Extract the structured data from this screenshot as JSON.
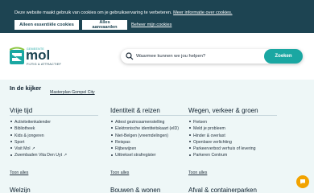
{
  "cookie": {
    "text": "Deze website maakt gebruik van cookies om je gebruikservaring te verbeteren.",
    "more_link": "Meer informatie over cookies.",
    "btn_essential": "Alleen essentiële cookies",
    "btn_adjust": "Alles aanvaarden",
    "reject_link": "Beheer mijn cookies"
  },
  "header": {
    "logo_top": "GEMEENTE",
    "logo_name": "mol",
    "logo_tagline": "FIJTIG & ATTRACTIEF",
    "search_placeholder": "Waarmee kunnen we jou helpen?",
    "search_button": "Zoeken"
  },
  "spotlight": {
    "title": "In de kijker",
    "link": "Masterplan Gompel City"
  },
  "columns": [
    {
      "title": "Vrije tijd",
      "items": [
        {
          "label": "Activiteitenkalender",
          "ext": false
        },
        {
          "label": "Bibliotheek",
          "ext": false
        },
        {
          "label": "Kids & jongeren",
          "ext": false
        },
        {
          "label": "Sport",
          "ext": false
        },
        {
          "label": "Visit Mol",
          "ext": true
        },
        {
          "label": "Zwembaden Vita Den Uyt",
          "ext": true
        }
      ],
      "see_all": "Toon alles"
    },
    {
      "title": "Identiteit & reizen",
      "items": [
        {
          "label": "Attest gezinssamenstelling",
          "ext": false
        },
        {
          "label": "Elektronische identiteitskaart (eID)",
          "ext": false
        },
        {
          "label": "Niet-Belgen (vreemdelingen)",
          "ext": false
        },
        {
          "label": "Reispas",
          "ext": false
        },
        {
          "label": "Rijbewijzen",
          "ext": false
        },
        {
          "label": "Uittreksel strafregister",
          "ext": false
        }
      ],
      "see_all": "Toon alles"
    },
    {
      "title": "Wegen, verkeer & groen",
      "items": [
        {
          "label": "Fietsen",
          "ext": false
        },
        {
          "label": "Meld je probleem",
          "ext": false
        },
        {
          "label": "Hinder & overlast",
          "ext": false
        },
        {
          "label": "Openbare verlichting",
          "ext": false
        },
        {
          "label": "Parkeerverbod verhuis of levering",
          "ext": false
        },
        {
          "label": "Parkeren Centrum",
          "ext": false
        }
      ],
      "see_all": "Toon alles"
    }
  ],
  "next_titles": [
    "Welzijn",
    "Bouwen & wonen",
    "Afval & containerparken"
  ],
  "colors": {
    "cookie_bg": "#1d4452",
    "accent": "#1aa7a2",
    "fab": "#f2a300"
  }
}
